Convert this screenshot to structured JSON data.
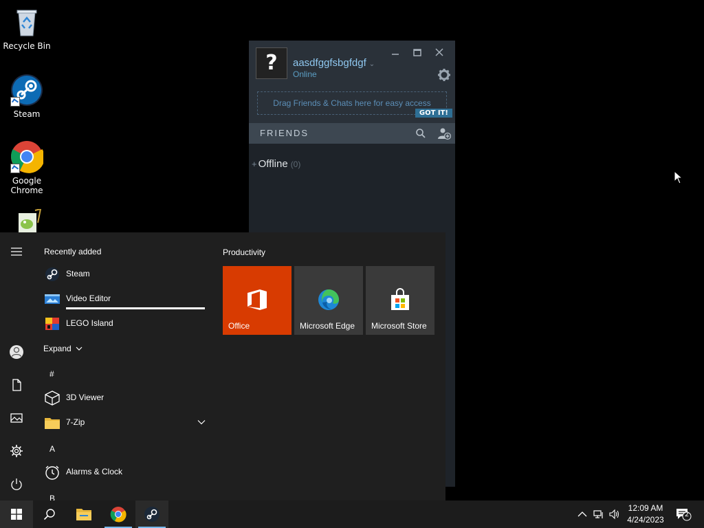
{
  "desktop": {
    "icons": [
      {
        "label": "Recycle Bin",
        "icon": "recycle-bin-icon"
      },
      {
        "label": "Steam",
        "icon": "steam-icon"
      },
      {
        "label": "Google Chrome",
        "icon": "chrome-icon"
      },
      {
        "label": "",
        "icon": "notepad-plus-plus-icon"
      }
    ]
  },
  "steam": {
    "avatar": "?",
    "username": "aasdfggfsbgfdgf",
    "status": "Online",
    "drop_hint": "Drag Friends & Chats here for easy access",
    "got_it": "GOT IT!",
    "friends_title": "FRIENDS",
    "group_name": "Offline",
    "group_count": "(0)",
    "colors": {
      "username": "#8fc7ef",
      "panel": "#1e2329",
      "header": "#2a3139"
    }
  },
  "start_menu": {
    "recent_title": "Recently added",
    "recent": [
      {
        "label": "Steam",
        "icon": "steam-icon"
      },
      {
        "label": "Video Editor",
        "icon": "video-editor-icon"
      },
      {
        "label": "LEGO Island",
        "icon": "lego-island-icon"
      }
    ],
    "expand_label": "Expand",
    "sections": [
      {
        "letter": "#"
      },
      {
        "letter": "A"
      },
      {
        "letter": "B"
      }
    ],
    "apps": [
      {
        "label": "3D Viewer",
        "icon": "cube-icon"
      },
      {
        "label": "7-Zip",
        "icon": "folder-icon"
      },
      {
        "label": "Alarms & Clock",
        "icon": "alarm-clock-icon"
      }
    ],
    "productivity_title": "Productivity",
    "tiles": [
      {
        "label": "Office",
        "icon": "office-icon",
        "color": "#d83b01"
      },
      {
        "label": "Microsoft Edge",
        "icon": "edge-icon",
        "color": "#3a3a3a"
      },
      {
        "label": "Microsoft Store",
        "icon": "store-icon",
        "color": "#3a3a3a"
      }
    ]
  },
  "taskbar": {
    "time": "12:09 AM",
    "date": "4/24/2023",
    "notification_count": "2",
    "accent": "#76b9ed"
  }
}
